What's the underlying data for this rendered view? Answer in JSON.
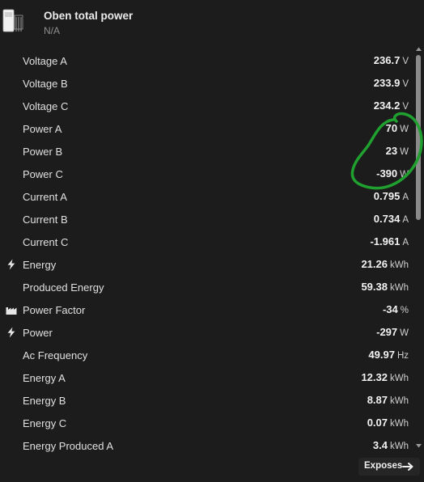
{
  "header": {
    "title": "Oben total power",
    "subtitle": "N/A",
    "device_icon": "power-meter-icon"
  },
  "rows": [
    {
      "label": "Voltage A",
      "value": "236.7",
      "unit": "V",
      "icon": null
    },
    {
      "label": "Voltage B",
      "value": "233.9",
      "unit": "V",
      "icon": null
    },
    {
      "label": "Voltage C",
      "value": "234.2",
      "unit": "V",
      "icon": null
    },
    {
      "label": "Power A",
      "value": "70",
      "unit": "W",
      "icon": null
    },
    {
      "label": "Power B",
      "value": "23",
      "unit": "W",
      "icon": null
    },
    {
      "label": "Power C",
      "value": "-390",
      "unit": "W",
      "icon": null
    },
    {
      "label": "Current A",
      "value": "0.795",
      "unit": "A",
      "icon": null
    },
    {
      "label": "Current B",
      "value": "0.734",
      "unit": "A",
      "icon": null
    },
    {
      "label": "Current C",
      "value": "-1.961",
      "unit": "A",
      "icon": null
    },
    {
      "label": "Energy",
      "value": "21.26",
      "unit": "kWh",
      "icon": "lightning-icon"
    },
    {
      "label": "Produced Energy",
      "value": "59.38",
      "unit": "kWh",
      "icon": null
    },
    {
      "label": "Power Factor",
      "value": "-34",
      "unit": "%",
      "icon": "factory-icon"
    },
    {
      "label": "Power",
      "value": "-297",
      "unit": "W",
      "icon": "lightning-icon"
    },
    {
      "label": "Ac Frequency",
      "value": "49.97",
      "unit": "Hz",
      "icon": null
    },
    {
      "label": "Energy A",
      "value": "12.32",
      "unit": "kWh",
      "icon": null
    },
    {
      "label": "Energy B",
      "value": "8.87",
      "unit": "kWh",
      "icon": null
    },
    {
      "label": "Energy C",
      "value": "0.07",
      "unit": "kWh",
      "icon": null
    },
    {
      "label": "Energy Produced A",
      "value": "3.4",
      "unit": "kWh",
      "icon": null
    }
  ],
  "footer": {
    "expose_label": "Exposes",
    "expose_icon": "arrow-right-icon"
  },
  "annotation": {
    "color": "#1fa02f",
    "target": "Power A, Power B, Power C values circled"
  },
  "colors": {
    "background": "#1c1c1c",
    "scrollbar_thumb": "#8a8a8a"
  }
}
